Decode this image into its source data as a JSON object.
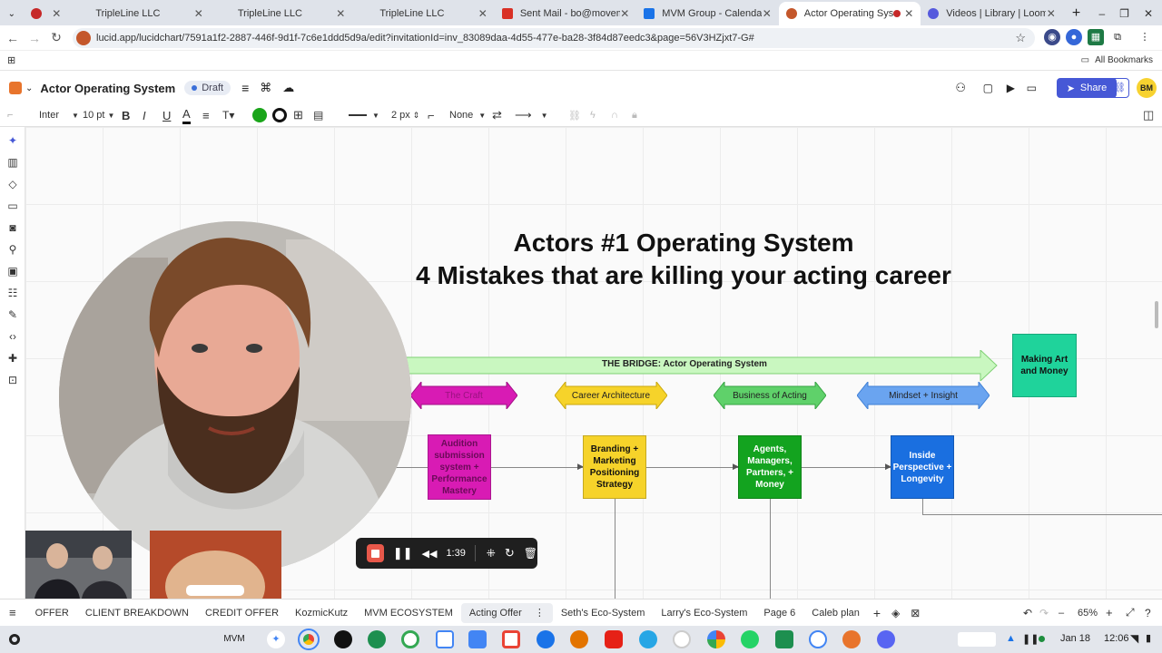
{
  "browser": {
    "tabs": [
      {
        "label": "",
        "color": "#c62828"
      },
      {
        "label": "TripleLine LLC",
        "color": ""
      },
      {
        "label": "TripleLine LLC",
        "color": ""
      },
      {
        "label": "TripleLine LLC",
        "color": ""
      },
      {
        "label": "Sent Mail - bo@movementgro",
        "color": "#d93025"
      },
      {
        "label": "MVM Group - Calendar - Week",
        "color": "#1a73e8"
      },
      {
        "label": "Actor Operating System: Lu",
        "color": "#c4572b"
      },
      {
        "label": "Videos | Library | Loom",
        "color": "#565add"
      }
    ],
    "new_tab": "+",
    "url": "lucid.app/lucidchart/7591a1f2-2887-446f-9d1f-7c6e1ddd5d9a/edit?invitationId=inv_83089daa-4d55-477e-ba28-3f84d87eedc3&page=56V3HZjxt7-G#",
    "bookmarks_label": "All Bookmarks"
  },
  "app": {
    "doc_title": "Actor Operating System",
    "status": "Draft",
    "share_label": "Share",
    "avatar_initials": "BM",
    "accent": "#4658d6"
  },
  "toolbar": {
    "font": "Inter",
    "font_size": "10 pt",
    "bold": "B",
    "italic": "I",
    "underline": "U",
    "text_color": "A",
    "line_width": "2 px",
    "end_style": "None"
  },
  "canvas": {
    "title_line1": "Actors #1 Operating System",
    "title_line2": "4  Mistakes that are killing your acting career",
    "bridge_label": "THE BRIDGE:  Actor Operating System",
    "goal_box": "Making Art and Money",
    "categories": [
      "The Craft",
      "Career Architecture",
      "Business of Acting",
      "Mindset + Insight"
    ],
    "boxes": [
      "Audition submission system + Performance Mastery",
      "Branding + Marketing Positioning Strategy",
      "Agents, Managers, Partners, + Money",
      "Inside Perspective + Longevity"
    ],
    "colors": {
      "bridge": "#c9f7c0",
      "goal": "#1fd39b",
      "craft": "#d81bb4",
      "career": "#f6d32a",
      "business": "#5fd16a",
      "mindset": "#6aa4f0",
      "box_craft": "#d81bb4",
      "box_career": "#f6d32a",
      "box_business": "#13a31f",
      "box_mindset": "#1a6fe0"
    }
  },
  "recorder": {
    "time": "1:39"
  },
  "pages": [
    "OFFER",
    "CLIENT BREAKDOWN",
    "CREDIT OFFER",
    "KozmicKutz",
    "MVM ECOSYSTEM",
    "Acting Offer",
    "Seth's Eco-System",
    "Larry's Eco-System",
    "Page 6",
    "Caleb plan"
  ],
  "active_page": "Acting Offer",
  "zoom": "65%",
  "taskbar": {
    "profile": "MVM",
    "date": "Jan 18",
    "time": "12:06"
  }
}
